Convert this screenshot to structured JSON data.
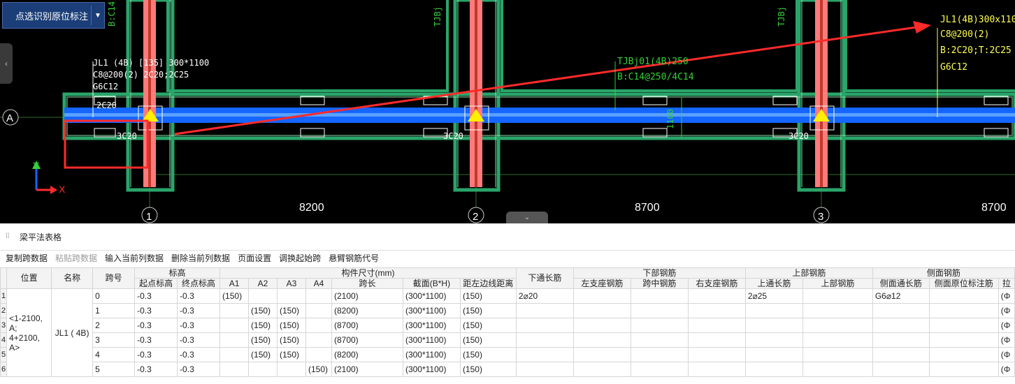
{
  "toolbar_button": {
    "label": "点选识别原位标注",
    "dropdown": "▼"
  },
  "side_tab_glyph": "‹",
  "collapse_glyph": "⌄",
  "cad": {
    "axis_a": "A",
    "axis_numbers": [
      "1",
      "2",
      "3"
    ],
    "span_dims": [
      "8200",
      "8700",
      "8700"
    ],
    "beam_label_white": [
      "JL1 (4B) [135] 300*1100",
      "C8@200(2) 2C20;2C25",
      "G6C12"
    ],
    "beam_label_yellow": [
      "JL1(4B)300x1100",
      "C8@200(2)",
      "B:2C20;T:2C25",
      "G6C12"
    ],
    "tjb_label": [
      "TJBj01(4B)250",
      "B:C14@250/4C14"
    ],
    "tjb_side_top": "TJBj",
    "bc_side": "B:C14",
    "rebar_2c20": "2C20",
    "rebar_3c20": [
      "3C20",
      "3C20",
      "3C20"
    ],
    "dim_1100": "1100",
    "ucs_y": "Y",
    "ucs_x": "X",
    "colors": {
      "beam_blue": "#1565ff",
      "beam_green": "#2aa56a",
      "column_red": "#ff7a7a",
      "label_yellow": "#ffff4d",
      "label_green": "#35d035",
      "arrow_red": "#ff2a2a"
    }
  },
  "panel": {
    "grip_icon": "⁞⁞",
    "title": "梁平法表格",
    "actions": [
      {
        "label": "复制跨数据",
        "enabled": true
      },
      {
        "label": "粘贴跨数据",
        "enabled": false
      },
      {
        "label": "输入当前列数据",
        "enabled": true
      },
      {
        "label": "删除当前列数据",
        "enabled": true
      },
      {
        "label": "页面设置",
        "enabled": true
      },
      {
        "label": "调换起始跨",
        "enabled": true
      },
      {
        "label": "悬臂钢筋代号",
        "enabled": true
      }
    ]
  },
  "table": {
    "group_headers": {
      "elevation": "标高",
      "size": "构件尺寸(mm)",
      "bottom": "下部钢筋",
      "top": "上部钢筋",
      "side": "侧面钢筋"
    },
    "headers": {
      "position": "位置",
      "name": "名称",
      "span": "跨号",
      "start_elev": "起点标高",
      "end_elev": "终点标高",
      "a1": "A1",
      "a2": "A2",
      "a3": "A3",
      "a4": "A4",
      "span_len": "跨长",
      "section": "截面(B*H)",
      "edge": "距左边线距离",
      "bottom_through": "下通长筋",
      "left_seat": "左支座钢筋",
      "mid_span": "跨中钢筋",
      "right_seat": "右支座钢筋",
      "top_through": "上通长筋",
      "top_bar": "上部钢筋",
      "side_through": "侧面通长筋",
      "side_in_situ": "侧面原位标注筋",
      "tie": "拉"
    },
    "position_lines": [
      "<1-2100,",
      "A;",
      "4+2100,",
      "A>"
    ],
    "name": "JL1 ( 4B)",
    "rows": [
      {
        "n": "1",
        "span": "0",
        "s": "-0.3",
        "e": "-0.3",
        "a1": "(150)",
        "a2": "",
        "a3": "",
        "a4": "",
        "len": "(2100)",
        "sec": "(300*1100)",
        "edge": "(150)",
        "bt": "2⌀20",
        "tt": "2⌀25",
        "side": "G6⌀12",
        "tie": "(Φ"
      },
      {
        "n": "2",
        "span": "1",
        "s": "-0.3",
        "e": "-0.3",
        "a1": "",
        "a2": "(150)",
        "a3": "(150)",
        "a4": "",
        "len": "(8200)",
        "sec": "(300*1100)",
        "edge": "(150)",
        "bt": "",
        "tt": "",
        "side": "",
        "tie": "(Φ"
      },
      {
        "n": "3",
        "span": "2",
        "s": "-0.3",
        "e": "-0.3",
        "a1": "",
        "a2": "(150)",
        "a3": "(150)",
        "a4": "",
        "len": "(8700)",
        "sec": "(300*1100)",
        "edge": "(150)",
        "bt": "",
        "tt": "",
        "side": "",
        "tie": "(Φ"
      },
      {
        "n": "4",
        "span": "3",
        "s": "-0.3",
        "e": "-0.3",
        "a1": "",
        "a2": "(150)",
        "a3": "(150)",
        "a4": "",
        "len": "(8700)",
        "sec": "(300*1100)",
        "edge": "(150)",
        "bt": "",
        "tt": "",
        "side": "",
        "tie": "(Φ"
      },
      {
        "n": "5",
        "span": "4",
        "s": "-0.3",
        "e": "-0.3",
        "a1": "",
        "a2": "(150)",
        "a3": "(150)",
        "a4": "",
        "len": "(8200)",
        "sec": "(300*1100)",
        "edge": "(150)",
        "bt": "",
        "tt": "",
        "side": "",
        "tie": "(Φ"
      },
      {
        "n": "6",
        "span": "5",
        "s": "-0.3",
        "e": "-0.3",
        "a1": "",
        "a2": "",
        "a3": "",
        "a4": "(150)",
        "len": "(2100)",
        "sec": "(300*1100)",
        "edge": "(150)",
        "bt": "",
        "tt": "",
        "side": "",
        "tie": "(Φ"
      }
    ]
  }
}
